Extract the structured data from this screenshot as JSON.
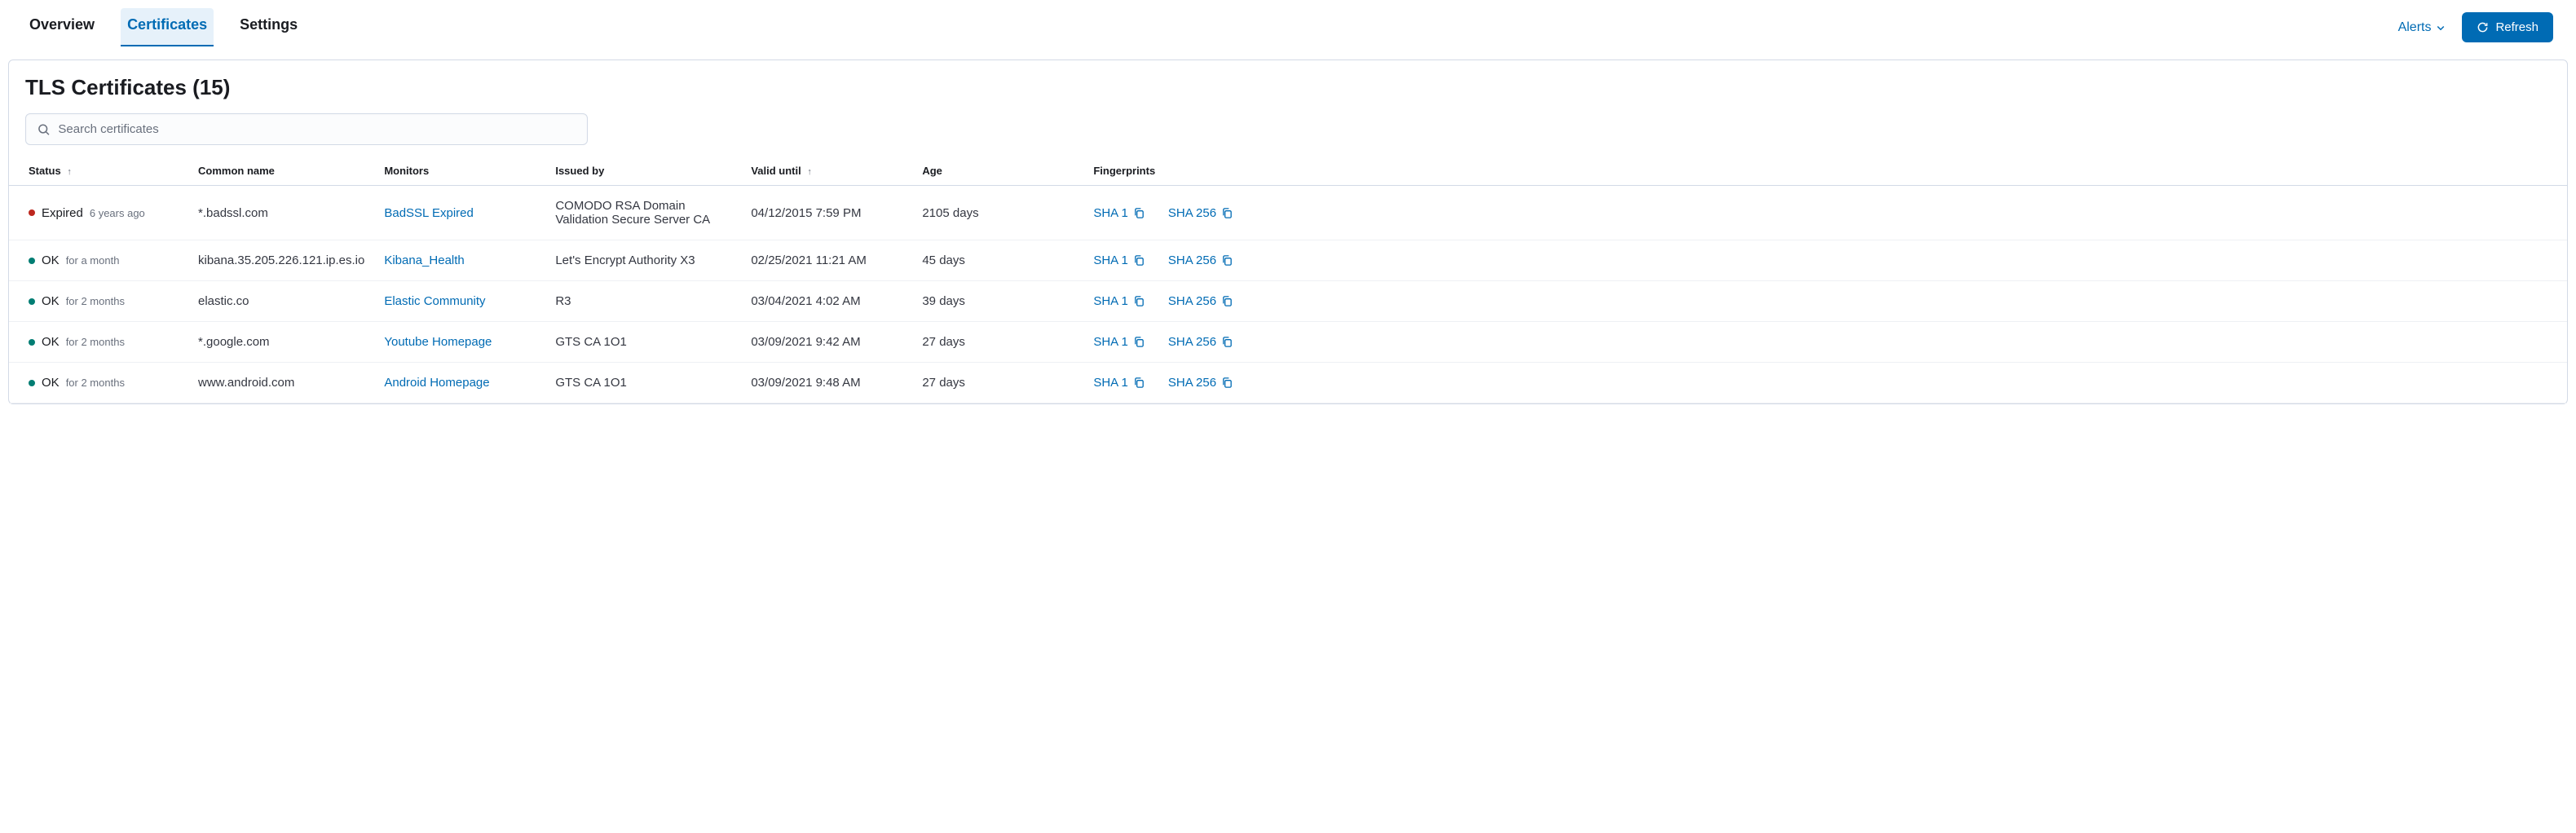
{
  "tabs": {
    "overview": "Overview",
    "certificates": "Certificates",
    "settings": "Settings"
  },
  "topbar": {
    "alerts_label": "Alerts",
    "refresh_label": "Refresh"
  },
  "panel_title": "TLS Certificates (15)",
  "search": {
    "placeholder": "Search certificates"
  },
  "columns": {
    "status": "Status",
    "common_name": "Common name",
    "monitors": "Monitors",
    "issued_by": "Issued by",
    "valid_until": "Valid until",
    "age": "Age",
    "fingerprints": "Fingerprints"
  },
  "fingerprint_labels": {
    "sha1": "SHA 1",
    "sha256": "SHA 256"
  },
  "rows": [
    {
      "status": "Expired",
      "status_color": "red",
      "status_sub": "6 years ago",
      "common_name": "*.badssl.com",
      "monitor": "BadSSL Expired",
      "issued_by": "COMODO RSA Domain Validation Secure Server CA",
      "valid_until": "04/12/2015 7:59 PM",
      "age": "2105 days"
    },
    {
      "status": "OK",
      "status_color": "green",
      "status_sub": "for a month",
      "common_name": "kibana.35.205.226.121.ip.es.io",
      "monitor": "Kibana_Health",
      "issued_by": "Let's Encrypt Authority X3",
      "valid_until": "02/25/2021 11:21 AM",
      "age": "45 days"
    },
    {
      "status": "OK",
      "status_color": "green",
      "status_sub": "for 2 months",
      "common_name": "elastic.co",
      "monitor": "Elastic Community",
      "issued_by": "R3",
      "valid_until": "03/04/2021 4:02 AM",
      "age": "39 days"
    },
    {
      "status": "OK",
      "status_color": "green",
      "status_sub": "for 2 months",
      "common_name": "*.google.com",
      "monitor": "Youtube Homepage",
      "issued_by": "GTS CA 1O1",
      "valid_until": "03/09/2021 9:42 AM",
      "age": "27 days"
    },
    {
      "status": "OK",
      "status_color": "green",
      "status_sub": "for 2 months",
      "common_name": "www.android.com",
      "monitor": "Android Homepage",
      "issued_by": "GTS CA 1O1",
      "valid_until": "03/09/2021 9:48 AM",
      "age": "27 days"
    }
  ]
}
